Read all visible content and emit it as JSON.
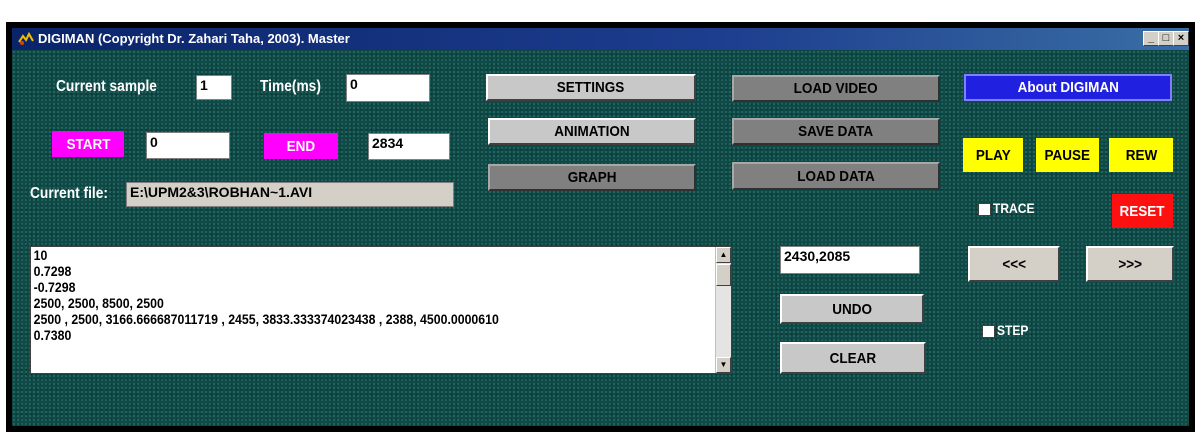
{
  "window": {
    "title": "DIGIMAN (Copyright Dr. Zahari Taha, 2003).  Master",
    "controls": {
      "minimize": "_",
      "maximize": "□",
      "close": "×"
    }
  },
  "sample": {
    "label": "Current sample",
    "value": "1"
  },
  "time": {
    "label": "Time(ms)",
    "value": "0"
  },
  "start": {
    "label": "START",
    "value": "0"
  },
  "end": {
    "label": "END",
    "value": "2834"
  },
  "file": {
    "label": "Current  file:",
    "value": "E:\\UPM2&3\\ROBHAN~1.AVI"
  },
  "buttons": {
    "settings": "SETTINGS",
    "animation": "ANIMATION",
    "graph": "GRAPH",
    "load_video": "LOAD VIDEO",
    "save_data": "SAVE DATA",
    "load_data": "LOAD DATA",
    "about": "About DIGIMAN",
    "play": "PLAY",
    "pause": "PAUSE",
    "rew": "REW",
    "reset": "RESET",
    "prev": "<<<",
    "next": ">>>",
    "undo": "UNDO",
    "clear": "CLEAR"
  },
  "trace": {
    "label": "TRACE",
    "checked": false
  },
  "step": {
    "label": "STEP",
    "checked": false
  },
  "coords": {
    "value": "2430,2085"
  },
  "output": {
    "lines": [
      "10",
      "0.7298",
      "-0.7298",
      "2500, 2500, 8500, 2500",
      " 2500 ,  2500, 3166.666687011719 ,  2455, 3833.333374023438 ,  2388, 4500.0000610",
      "0.7380"
    ]
  },
  "colors": {
    "background": "#0f4a47",
    "titlebar": "#0a246a",
    "magenta": "#ff00ff",
    "yellow": "#ffff00",
    "red": "#ff1010",
    "about_blue": "#2020e0"
  }
}
